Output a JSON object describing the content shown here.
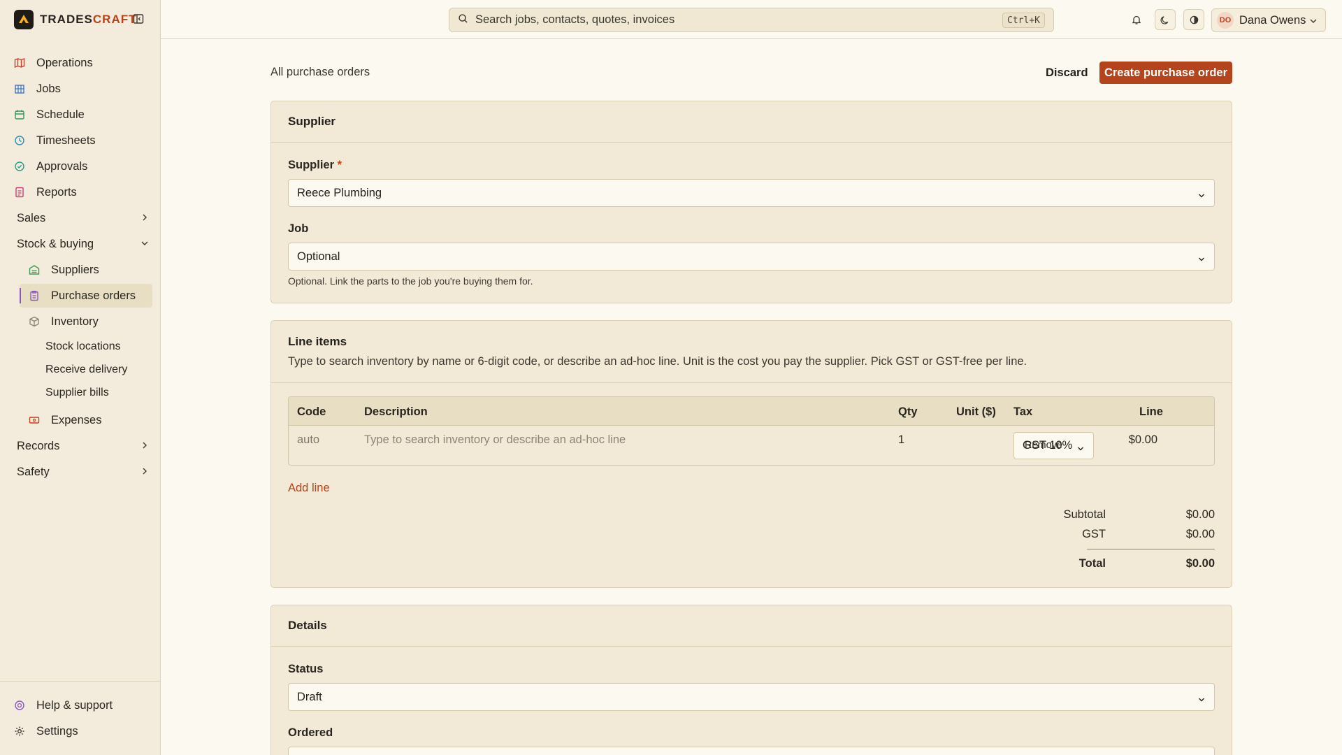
{
  "brand": {
    "part1": "TRADES",
    "part2": "CRAFT"
  },
  "sidebar": {
    "items": [
      {
        "label": "Operations",
        "icon": "map-icon"
      },
      {
        "label": "Jobs",
        "icon": "building-icon"
      },
      {
        "label": "Schedule",
        "icon": "calendar-icon"
      },
      {
        "label": "Timesheets",
        "icon": "clock-icon"
      },
      {
        "label": "Approvals",
        "icon": "check-circle-icon"
      },
      {
        "label": "Reports",
        "icon": "report-icon"
      }
    ],
    "groups": {
      "sales": "Sales",
      "stock": "Stock & buying",
      "records": "Records",
      "safety": "Safety"
    },
    "stock_items": [
      {
        "label": "Suppliers",
        "icon": "warehouse-icon"
      },
      {
        "label": "Purchase orders",
        "icon": "clipboard-icon"
      },
      {
        "label": "Inventory",
        "icon": "box-icon"
      }
    ],
    "inventory_sub": [
      "Stock locations",
      "Receive delivery",
      "Supplier bills"
    ],
    "expenses": "Expenses",
    "footer": {
      "help": "Help & support",
      "settings": "Settings"
    }
  },
  "topbar": {
    "search_placeholder": "Search jobs, contacts, quotes, invoices",
    "shortcut": "Ctrl+K",
    "user_initials": "DO",
    "user_name": "Dana Owens"
  },
  "page": {
    "breadcrumb": "All purchase orders",
    "discard": "Discard",
    "create": "Create purchase order"
  },
  "supplier_card": {
    "title": "Supplier",
    "supplier_label": "Supplier",
    "required_mark": "*",
    "supplier_value": "Reece Plumbing",
    "job_label": "Job",
    "job_value": "Optional",
    "job_hint": "Optional. Link the parts to the job you're buying them for."
  },
  "line_items": {
    "title": "Line items",
    "description": "Type to search inventory by name or 6-digit code, or describe an ad-hoc line. Unit is the cost you pay the supplier. Pick GST or GST-free per line.",
    "columns": {
      "code": "Code",
      "description": "Description",
      "qty": "Qty",
      "unit": "Unit ($)",
      "tax": "Tax",
      "line": "Line"
    },
    "row": {
      "code": "auto",
      "description_placeholder": "Type to search inventory or describe an ad-hoc line",
      "qty": "1",
      "tax": "GST 10%",
      "line": "$0.00",
      "remove": "Remove"
    },
    "add_line": "Add line",
    "totals": {
      "subtotal_label": "Subtotal",
      "subtotal": "$0.00",
      "gst_label": "GST",
      "gst": "$0.00",
      "total_label": "Total",
      "total": "$0.00"
    }
  },
  "details_card": {
    "title": "Details",
    "status_label": "Status",
    "status_value": "Draft",
    "ordered_label": "Ordered"
  },
  "colors": {
    "accent": "#b5431b",
    "sidebar_bg": "#f3ecdc",
    "card_bg": "#f2ead6",
    "page_bg": "#fcf9f1"
  }
}
